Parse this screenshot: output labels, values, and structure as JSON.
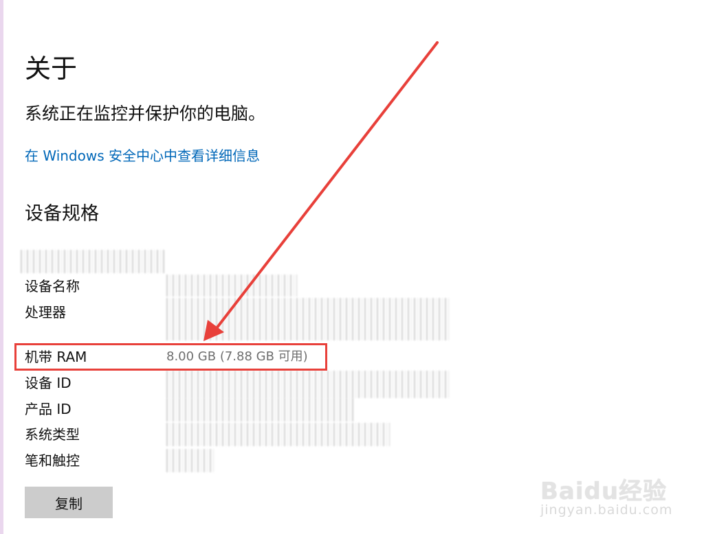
{
  "page": {
    "title": "关于",
    "protection_status": "系统正在监控并保护你的电脑。",
    "security_link": "在 Windows 安全中心中查看详细信息",
    "specs_heading": "设备规格"
  },
  "specs": {
    "device_name_label": "设备名称",
    "processor_label": "处理器",
    "ram_label": "机带 RAM",
    "ram_value": "8.00 GB (7.88 GB 可用)",
    "device_id_label": "设备 ID",
    "product_id_label": "产品 ID",
    "system_type_label": "系统类型",
    "pen_touch_label": "笔和触控"
  },
  "actions": {
    "copy_label": "复制"
  },
  "annotation": {
    "highlight_color": "#e8403a",
    "arrow_color": "#e8403a"
  },
  "watermark": {
    "logo": "Baidu经验",
    "url": "jingyan.baidu.com"
  }
}
